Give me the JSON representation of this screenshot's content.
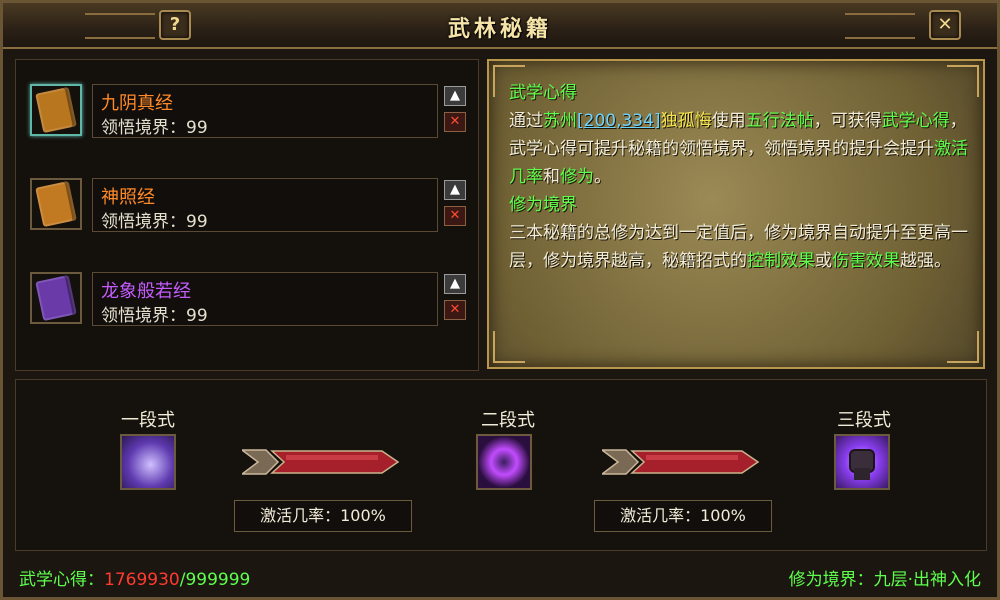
{
  "window": {
    "title": "武林秘籍",
    "help_label": "?",
    "close_label": "✕"
  },
  "books": [
    {
      "name": "九阴真经",
      "name_color": "#ff8a2a",
      "level_label": "领悟境界：99",
      "cover_color": "#b8761f",
      "selected": true
    },
    {
      "name": "神照经",
      "name_color": "#ff8a2a",
      "level_label": "领悟境界：99",
      "cover_color": "#c27a22",
      "selected": false
    },
    {
      "name": "龙象般若经",
      "name_color": "#c45cff",
      "level_label": "领悟境界：99",
      "cover_color": "#6a3aa8",
      "selected": false
    }
  ],
  "book_buttons": {
    "up": "▲",
    "delete": "✕"
  },
  "info": {
    "heading1": "武学心得",
    "p1_a": "通过",
    "p1_city": "苏州",
    "p1_coord": "[200,334]",
    "p1_npc": "独孤悔",
    "p1_b": "使用",
    "p1_item": "五行法帖",
    "p1_c": "，可获得",
    "p1_d": "武学心得",
    "p1_e": "，武学心得可提升秘籍的领悟境界，领悟境界的提升会提升",
    "p1_f": "激活几率",
    "p1_g": "和",
    "p1_h": "修为",
    "p1_i": "。",
    "heading2": "修为境界",
    "p2_a": "三本秘籍的总修为达到一定值后，修为境界自动提升至更高一层，修为境界越高，秘籍招式的",
    "p2_b": "控制效果",
    "p2_c": "或",
    "p2_d": "伤害效果",
    "p2_e": "越强。"
  },
  "skills": {
    "stages": [
      {
        "label": "一段式",
        "icon": "purple-claw-icon"
      },
      {
        "label": "二段式",
        "icon": "dark-grab-icon"
      },
      {
        "label": "三段式",
        "icon": "fist-icon"
      }
    ],
    "rates": [
      "激活几率：100%",
      "激活几率：100%"
    ]
  },
  "footer": {
    "left_label": "武学心得：",
    "current": "1769930",
    "max": "/999999",
    "right": "修为境界：九层·出神入化"
  },
  "colors": {
    "green": "#5dff4c",
    "red": "#ff3b2f",
    "cyan": "#6cd3ff",
    "gold": "#f6e3a8"
  }
}
